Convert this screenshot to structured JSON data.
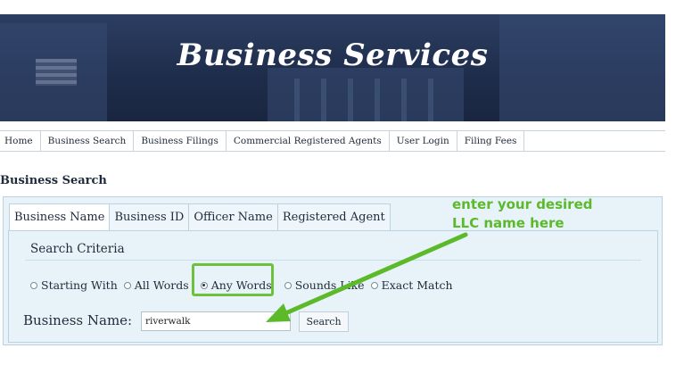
{
  "banner": {
    "title": "Business Services"
  },
  "nav": {
    "items": [
      "Home",
      "Business Search",
      "Business Filings",
      "Commercial Registered Agents",
      "User Login",
      "Filing Fees"
    ]
  },
  "page": {
    "heading": "Business Search"
  },
  "tabs": [
    {
      "label": "Business Name",
      "active": true
    },
    {
      "label": "Business ID",
      "active": false
    },
    {
      "label": "Officer Name",
      "active": false
    },
    {
      "label": "Registered Agent",
      "active": false
    }
  ],
  "search": {
    "criteria_title": "Search Criteria",
    "options": [
      {
        "label": "Starting With",
        "checked": false
      },
      {
        "label": "All Words",
        "checked": false
      },
      {
        "label": "Any Words",
        "checked": true
      },
      {
        "label": "Sounds Like",
        "checked": false
      },
      {
        "label": "Exact Match",
        "checked": false
      }
    ],
    "field_label": "Business Name:",
    "field_value": "riverwalk",
    "button_label": "Search"
  },
  "annotation": {
    "line1": "enter your desired",
    "line2": "LLC name here",
    "color": "#5cba2a"
  }
}
